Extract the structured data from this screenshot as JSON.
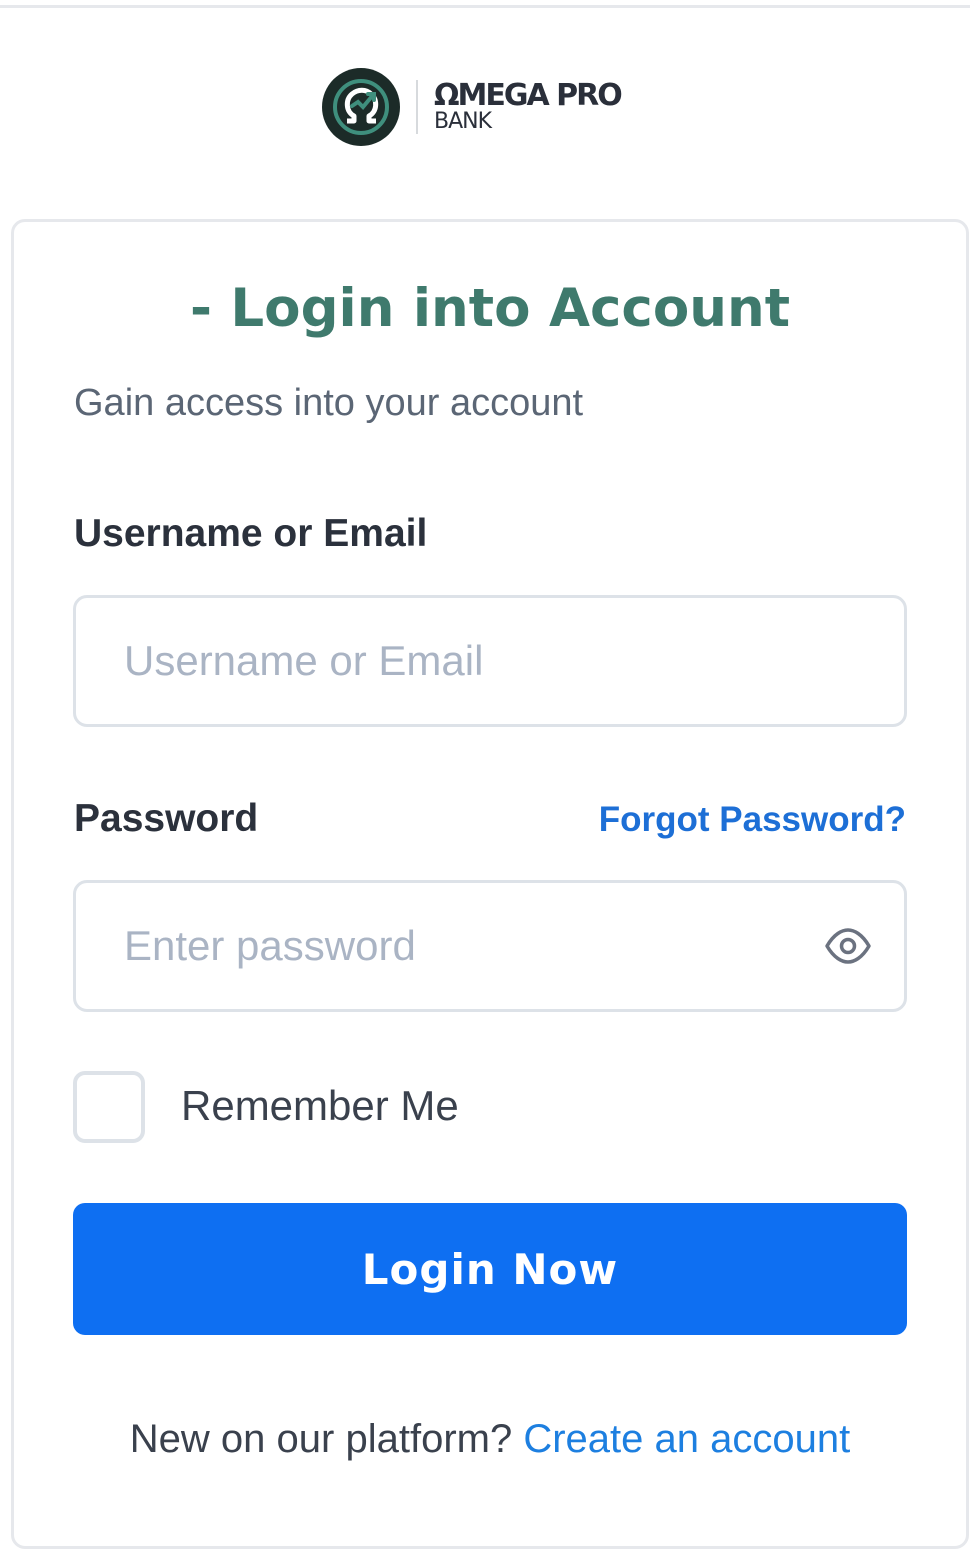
{
  "brand": {
    "name": "ΩMEGA PRO",
    "subtitle": "BANK",
    "logo_icon": "omega-logo-icon",
    "colors": {
      "logo_bg": "#1c2b28",
      "logo_accent": "#3f8f7d"
    }
  },
  "header": {
    "title": "- Login into Account",
    "subtitle": "Gain access into your account"
  },
  "form": {
    "username": {
      "label": "Username or Email",
      "placeholder": "Username or Email",
      "value": ""
    },
    "password": {
      "label": "Password",
      "placeholder": "Enter password",
      "value": "",
      "toggle_icon": "eye-icon"
    },
    "forgot_link": "Forgot Password?",
    "remember_me": {
      "label": "Remember Me",
      "checked": false
    },
    "submit_label": "Login Now"
  },
  "footer": {
    "prompt": "New on our platform?",
    "link": "Create an account"
  },
  "colors": {
    "title": "#3f7a6d",
    "primary": "#0e6ff2",
    "link": "#1d6fd6"
  }
}
